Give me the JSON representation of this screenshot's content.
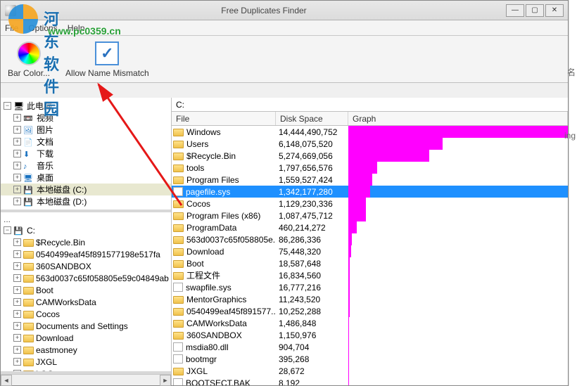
{
  "window": {
    "title": "Free Duplicates Finder"
  },
  "menubar": {
    "file": "File",
    "options": "Options",
    "help": "Help"
  },
  "toolbar": {
    "bar_color": "Bar Color...",
    "allow_mismatch": "Allow Name Mismatch"
  },
  "watermark": {
    "brand": "河东软件园",
    "url": "www.pc0359.cn"
  },
  "tree_top": {
    "root": "此电脑",
    "items": [
      {
        "label": "视频",
        "icon": "vid"
      },
      {
        "label": "图片",
        "icon": "img"
      },
      {
        "label": "文档",
        "icon": "doc"
      },
      {
        "label": "下载",
        "icon": "dl"
      },
      {
        "label": "音乐",
        "icon": "music"
      },
      {
        "label": "桌面",
        "icon": "desk"
      },
      {
        "label": "本地磁盘 (C:)",
        "icon": "drive",
        "hl": true
      },
      {
        "label": "本地磁盘 (D:)",
        "icon": "drive"
      }
    ]
  },
  "tree_bottom": {
    "root": "C:",
    "items": [
      "$Recycle.Bin",
      "0540499eaf45f891577198e517fa",
      "360SANDBOX",
      "563d0037c65f058805e59c04849ab",
      "Boot",
      "CAMWorksData",
      "Cocos",
      "Documents and Settings",
      "Download",
      "eastmoney",
      "JXGL",
      "LOG"
    ]
  },
  "right": {
    "path": "C:",
    "headers": {
      "file": "File",
      "disk": "Disk Space",
      "graph": "Graph"
    },
    "rows": [
      {
        "name": "Windows",
        "type": "folder",
        "size": "14,444,490,752",
        "bar": 100
      },
      {
        "name": "Users",
        "type": "folder",
        "size": "6,148,075,520",
        "bar": 43
      },
      {
        "name": "$Recycle.Bin",
        "type": "folder",
        "size": "5,274,669,056",
        "bar": 37
      },
      {
        "name": "tools",
        "type": "folder",
        "size": "1,797,656,576",
        "bar": 13
      },
      {
        "name": "Program Files",
        "type": "folder",
        "size": "1,559,527,424",
        "bar": 11
      },
      {
        "name": "pagefile.sys",
        "type": "file",
        "size": "1,342,177,280",
        "bar": 10,
        "selected": true
      },
      {
        "name": "Cocos",
        "type": "folder",
        "size": "1,129,230,336",
        "bar": 8
      },
      {
        "name": "Program Files (x86)",
        "type": "folder",
        "size": "1,087,475,712",
        "bar": 8
      },
      {
        "name": "ProgramData",
        "type": "folder",
        "size": "460,214,272",
        "bar": 4
      },
      {
        "name": "563d0037c65f058805e...",
        "type": "folder",
        "size": "86,286,336",
        "bar": 1.5
      },
      {
        "name": "Download",
        "type": "folder",
        "size": "75,448,320",
        "bar": 1.3
      },
      {
        "name": "Boot",
        "type": "folder",
        "size": "18,587,648",
        "bar": 0.8
      },
      {
        "name": "工程文件",
        "type": "folder",
        "size": "16,834,560",
        "bar": 0.7
      },
      {
        "name": "swapfile.sys",
        "type": "file",
        "size": "16,777,216",
        "bar": 0.7
      },
      {
        "name": "MentorGraphics",
        "type": "folder",
        "size": "11,243,520",
        "bar": 0.5
      },
      {
        "name": "0540499eaf45f891577...",
        "type": "folder",
        "size": "10,252,288",
        "bar": 0.5
      },
      {
        "name": "CAMWorksData",
        "type": "folder",
        "size": "1,486,848",
        "bar": 0.3
      },
      {
        "name": "360SANDBOX",
        "type": "folder",
        "size": "1,150,976",
        "bar": 0.3
      },
      {
        "name": "msdia80.dll",
        "type": "file",
        "size": "904,704",
        "bar": 0.2
      },
      {
        "name": "bootmgr",
        "type": "file",
        "size": "395,268",
        "bar": 0.2
      },
      {
        "name": "JXGL",
        "type": "folder",
        "size": "28,672",
        "bar": 0.1
      },
      {
        "name": "BOOTSECT.BAK",
        "type": "file",
        "size": "8,192",
        "bar": 0.1
      }
    ]
  },
  "edge": {
    "char1": "名",
    "char2": "ing"
  }
}
